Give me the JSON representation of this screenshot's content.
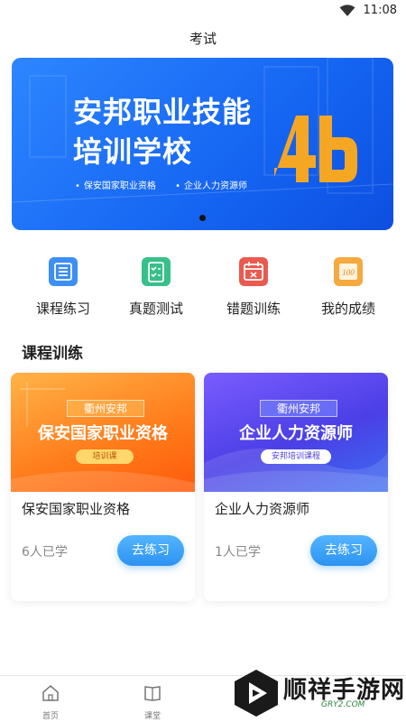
{
  "status_bar": {
    "time": "11:08"
  },
  "page": {
    "title": "考试"
  },
  "banner": {
    "headline_line1": "安邦职业技能",
    "headline_line2": "培训学校",
    "bullet1": "保安国家职业资格",
    "bullet2": "企业人力资源师"
  },
  "shortcuts": [
    {
      "label": "课程练习",
      "icon": "list-icon",
      "color": "#3d8ef5"
    },
    {
      "label": "真题测试",
      "icon": "checklist-icon",
      "color": "#36c08a"
    },
    {
      "label": "错题训练",
      "icon": "calendar-icon",
      "color": "#ea5a4f"
    },
    {
      "label": "我的成绩",
      "icon": "score-icon",
      "color": "#f5a93f"
    }
  ],
  "section": {
    "title": "课程训练"
  },
  "courses": [
    {
      "cover_tag": "衢州安邦",
      "cover_title": "保安国家职业资格",
      "cover_sub": "培训课",
      "title": "保安国家职业资格",
      "learners": "6人已学",
      "button": "去练习"
    },
    {
      "cover_tag": "衢州安邦",
      "cover_title": "企业人力资源师",
      "cover_sub": "安邦培训课程",
      "title": "企业人力资源师",
      "learners": "1人已学",
      "button": "去练习"
    }
  ],
  "tabbar": [
    {
      "label": "首页",
      "icon": "home-icon"
    },
    {
      "label": "课堂",
      "icon": "book-icon"
    }
  ],
  "watermark": {
    "text": "顺祥手游网",
    "url": "GRY2.COM"
  }
}
